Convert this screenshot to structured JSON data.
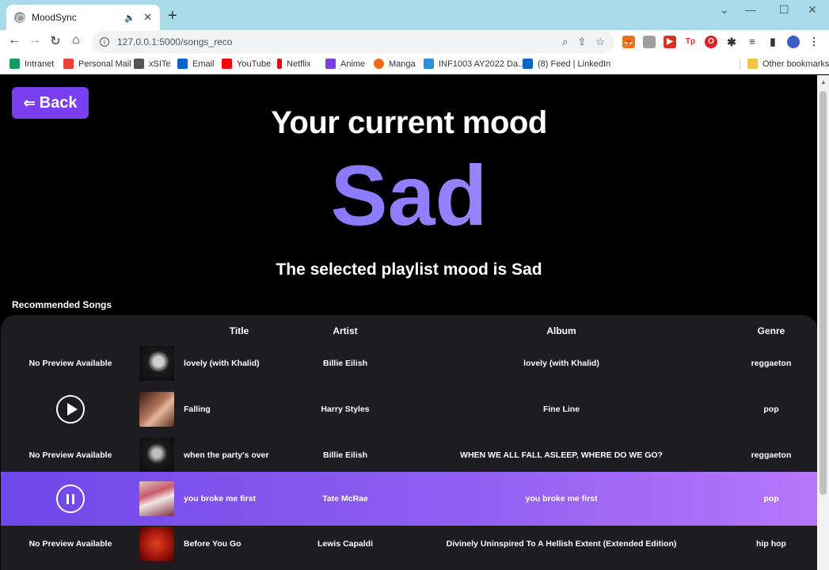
{
  "browser": {
    "tab_title": "MoodSync",
    "url": "127.0.0.1:5000/songs_reco",
    "bookmarks": [
      {
        "label": "Intranet",
        "color": "#1a9b5d"
      },
      {
        "label": "Personal Mail",
        "color": "#ea4335"
      },
      {
        "label": "xSITe",
        "color": "#555555"
      },
      {
        "label": "Email",
        "color": "#0a64c8"
      },
      {
        "label": "YouTube",
        "color": "#ff0000"
      },
      {
        "label": "Netflix",
        "color": "#e50914"
      },
      {
        "label": "Anime",
        "color": "#7b3fe4"
      },
      {
        "label": "Manga",
        "color": "#f26b1d"
      },
      {
        "label": "INF1003 AY2022 Da...",
        "color": "#2a8fd6"
      },
      {
        "label": "(8) Feed | LinkedIn",
        "color": "#0a66c2"
      }
    ],
    "other_bookmarks": "Other bookmarks"
  },
  "page": {
    "back_label": "Back",
    "heading": "Your current mood",
    "mood": "Sad",
    "subheading": "The selected playlist mood is Sad",
    "section_label": "Recommended Songs",
    "accent_color": "#7a3ff0"
  },
  "table": {
    "columns": [
      "Title",
      "Artist",
      "Album",
      "Genre"
    ],
    "rows": [
      {
        "preview": "No Preview Available",
        "preview_state": "none",
        "title": "lovely (with Khalid)",
        "artist": "Billie Eilish",
        "album": "lovely (with Khalid)",
        "genre": "reggaeton"
      },
      {
        "preview": "",
        "preview_state": "play",
        "title": "Falling",
        "artist": "Harry Styles",
        "album": "Fine Line",
        "genre": "pop"
      },
      {
        "preview": "No Preview Available",
        "preview_state": "none",
        "title": "when the party's over",
        "artist": "Billie Eilish",
        "album": "WHEN WE ALL FALL ASLEEP, WHERE DO WE GO?",
        "genre": "reggaeton"
      },
      {
        "preview": "",
        "preview_state": "pause",
        "title": "you broke me first",
        "artist": "Tate McRae",
        "album": "you broke me first",
        "genre": "pop"
      },
      {
        "preview": "No Preview Available",
        "preview_state": "none",
        "title": "Before You Go",
        "artist": "Lewis Capaldi",
        "album": "Divinely Uninspired To A Hellish Extent (Extended Edition)",
        "genre": "hip hop"
      }
    ]
  }
}
